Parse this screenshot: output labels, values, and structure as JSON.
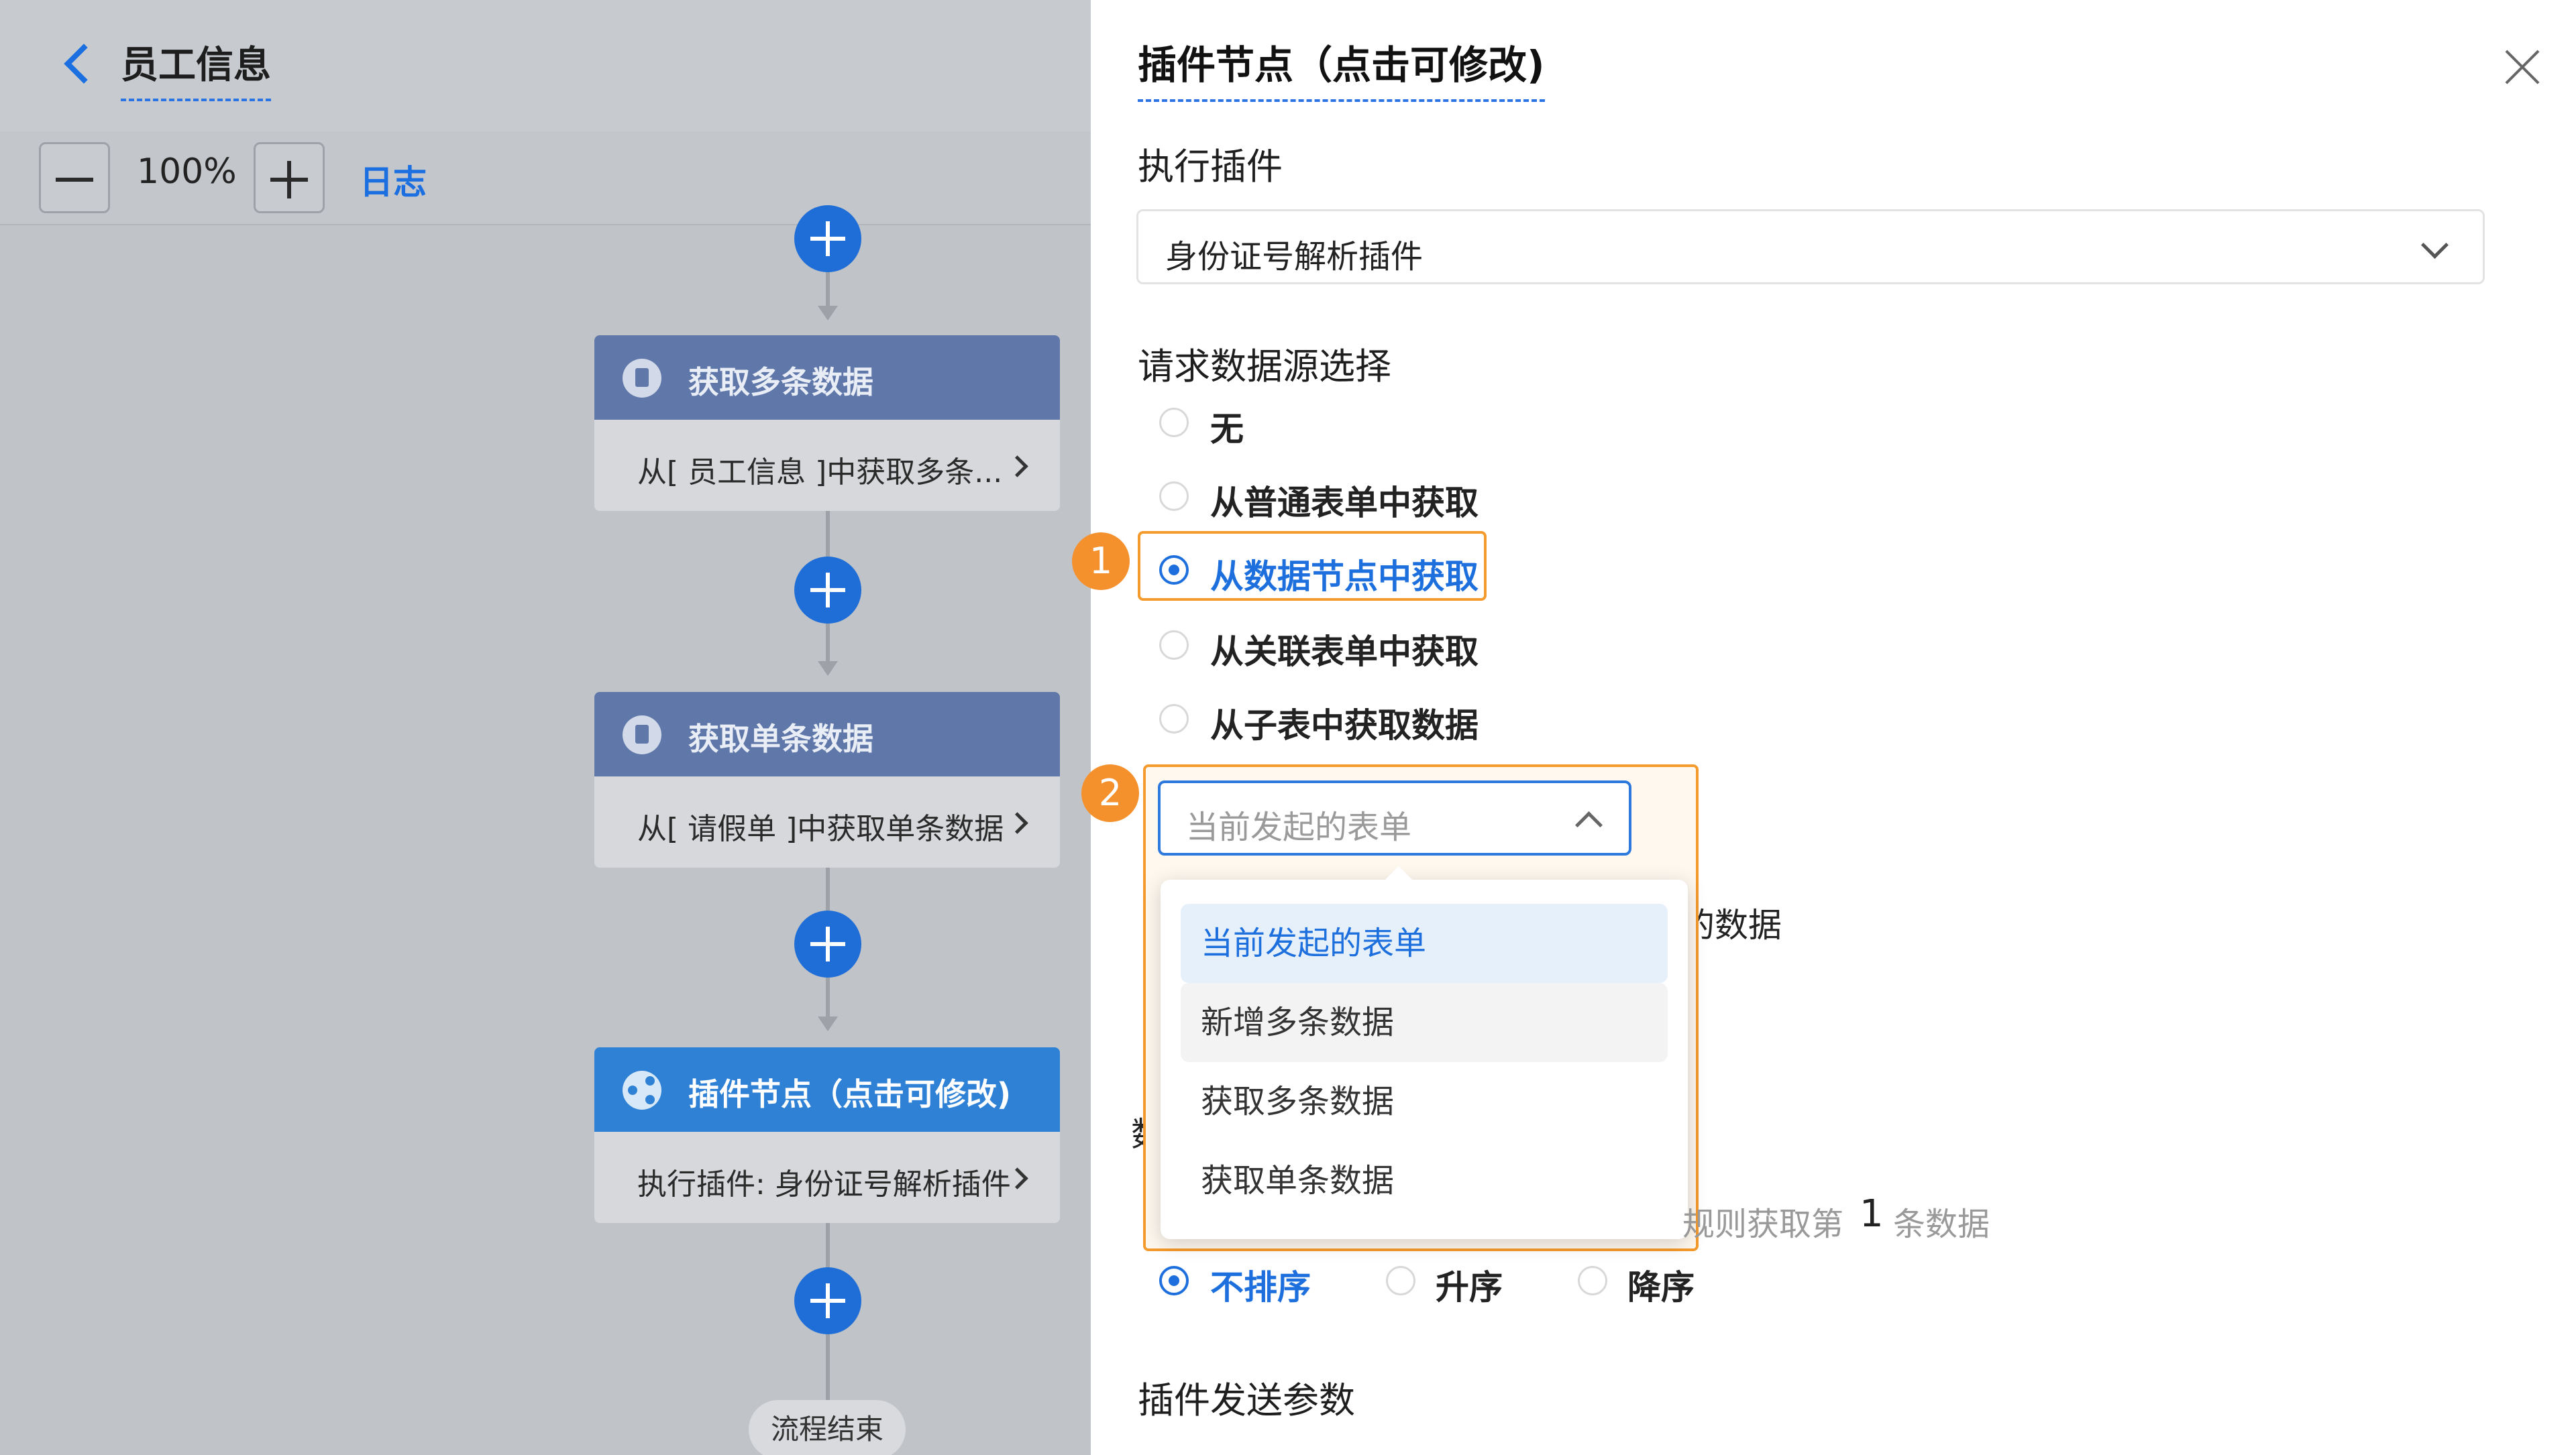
{
  "header": {
    "back_icon": "chevron-left-icon",
    "title": "员工信息"
  },
  "toolbar": {
    "zoom": "100%",
    "log_label": "日志"
  },
  "flow": {
    "nodes": [
      {
        "title": "获取多条数据",
        "desc": "从[ 员工信息 ]中获取多条...",
        "icon": "document-icon"
      },
      {
        "title": "获取单条数据",
        "desc": "从[ 请假单 ]中获取单条数据",
        "icon": "document-icon"
      },
      {
        "title": "插件节点（点击可修改)",
        "desc": "执行插件: 身份证号解析插件",
        "icon": "share-icon"
      }
    ],
    "end_label": "流程结束"
  },
  "panel": {
    "title": "插件节点（点击可修改)",
    "plugin_label": "执行插件",
    "plugin_value": "身份证号解析插件",
    "source_label": "请求数据源选择",
    "source_options": [
      "无",
      "从普通表单中获取",
      "从数据节点中获取",
      "从关联表单中获取",
      "从子表中获取数据"
    ],
    "source_selected": "从数据节点中获取",
    "badge1": "1",
    "badge2": "2",
    "dropdown": {
      "placeholder": "当前发起的表单",
      "options": [
        "当前发起的表单",
        "新增多条数据",
        "获取多条数据",
        "获取单条数据"
      ]
    },
    "partial_data_text": "的数据",
    "partial_number_text": "数",
    "rule_text_1": "规则获取第",
    "rule_number": "1",
    "rule_text_2": "条数据",
    "sort_options": [
      "不排序",
      "升序",
      "降序"
    ],
    "sort_selected": "不排序",
    "params_label": "插件发送参数"
  },
  "colors": {
    "accent": "#1c6fdc",
    "highlight": "#f5912d",
    "node_header": "#5f77a9",
    "node_header_active": "#2e81d5"
  }
}
